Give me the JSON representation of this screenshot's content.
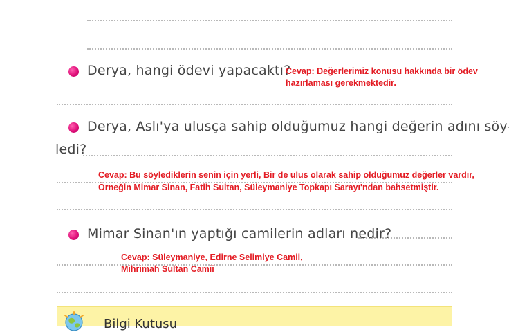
{
  "questions": {
    "q1": "Derya, hangi ödevi yapacaktı?",
    "q2_line1": "Derya, Aslı'ya ulusça sahip olduğumuz hangi değerin adını söy-",
    "q2_line2": "ledi?",
    "q3": "Mimar Sinan'ın yaptığı camilerin adları nedir?"
  },
  "answers": {
    "a1_line1": "Cevap: Değerlerimiz konusu hakkında bir ödev",
    "a1_line2": "hazırlaması gerekmektedir.",
    "a2_line1": "Cevap: Bu söylediklerin senin için yerli, Bir de ulus olarak sahip olduğumuz değerler vardır,",
    "a2_line2": "Örneğin Mimar Sinan, Fatih Sultan, Süleymaniye Topkapı Sarayı'ndan bahsetmiştir.",
    "a3_line1": "Cevap: Süleymaniye, Edirne Selimiye Camii,",
    "a3_line2": "Mihrimah Sultan Camii"
  },
  "info_box": {
    "title": "Bilgi Kutusu"
  },
  "colors": {
    "answer": "#e31b23",
    "bullet": "#e0117a",
    "info_box_bg": "#fdf3a6"
  }
}
